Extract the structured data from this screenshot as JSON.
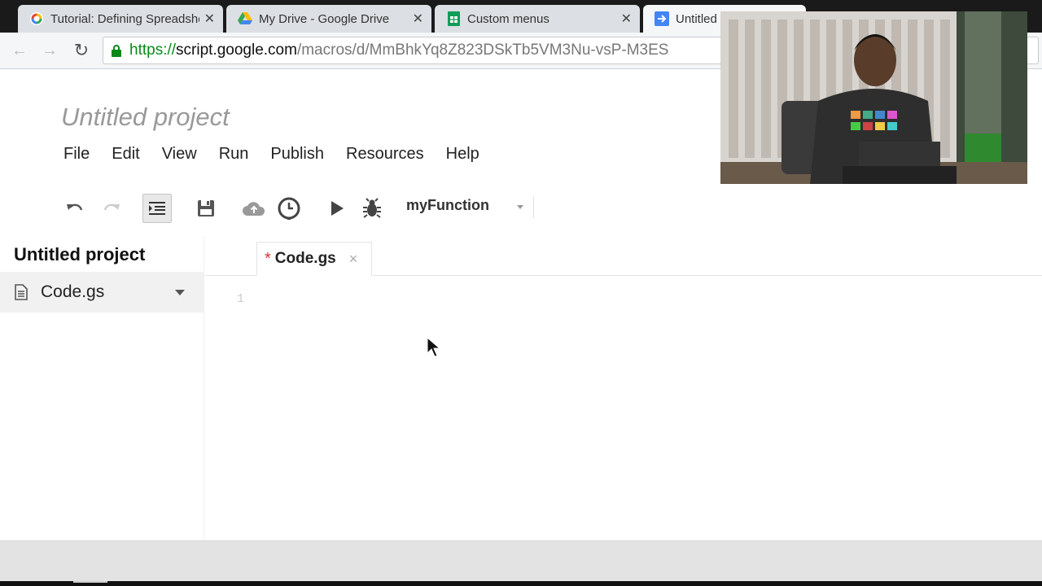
{
  "browser": {
    "tabs": [
      {
        "title": "Tutorial: Defining Spreadsheet",
        "icon": "google-apps-script-icon",
        "active": false
      },
      {
        "title": "My Drive - Google Drive",
        "icon": "google-drive-icon",
        "active": false
      },
      {
        "title": "Custom menus",
        "icon": "google-sheets-icon",
        "active": false
      },
      {
        "title": "Untitled",
        "icon": "apps-script-arrow-icon",
        "active": true
      }
    ],
    "url": {
      "scheme": "https://",
      "host": "script.google.com",
      "path": "/macros/d/MmBhkYq8Z823DSkTb5VM3Nu-vsP-M3ES"
    }
  },
  "editor": {
    "project_title": "Untitled project",
    "menu": [
      "File",
      "Edit",
      "View",
      "Run",
      "Publish",
      "Resources",
      "Help"
    ],
    "toolbar": {
      "function_select": "myFunction",
      "icons": [
        "undo-icon",
        "redo-icon",
        "indent-icon",
        "save-icon",
        "deploy-cloud-icon",
        "triggers-clock-icon",
        "run-icon",
        "debug-bug-icon"
      ]
    },
    "sidebar": {
      "title": "Untitled project",
      "files": [
        {
          "name": "Code.gs"
        }
      ]
    },
    "open_tab": {
      "label": "Code.gs",
      "unsaved_marker": "*",
      "close": "×"
    },
    "line_numbers": [
      "1"
    ]
  },
  "colors": {
    "url_scheme": "#0a8a1a",
    "dirty_marker": "#dd3333",
    "tab_strip": "#1a1a1a"
  }
}
